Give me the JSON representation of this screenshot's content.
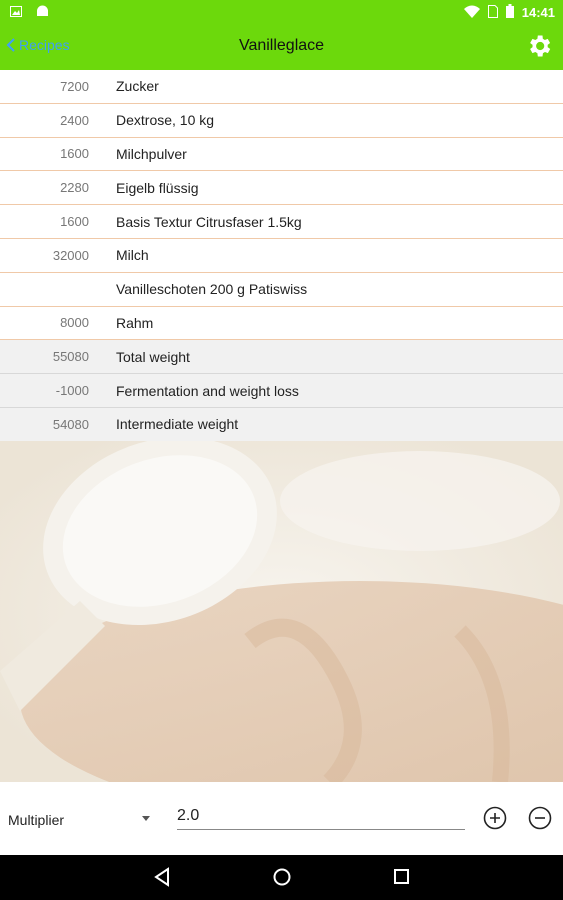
{
  "status": {
    "time": "14:41",
    "icons": [
      "image-icon",
      "android-icon",
      "wifi-icon",
      "sim-icon",
      "battery-icon"
    ]
  },
  "appbar": {
    "back_label": "Recipes",
    "title": "Vanilleglace",
    "settings_icon": "gear-icon",
    "color": "#6cd90c",
    "back_color": "#3fa0f5"
  },
  "ingredients": [
    {
      "amount": "7200",
      "name": "Zucker"
    },
    {
      "amount": "2400",
      "name": "Dextrose, 10 kg"
    },
    {
      "amount": "1600",
      "name": "Milchpulver"
    },
    {
      "amount": "2280",
      "name": "Eigelb flüssig"
    },
    {
      "amount": "1600",
      "name": "Basis Textur Citrusfaser 1.5kg"
    },
    {
      "amount": "32000",
      "name": "Milch"
    },
    {
      "amount": "",
      "name": "Vanilleschoten 200 g Patiswiss"
    },
    {
      "amount": "8000",
      "name": "Rahm"
    }
  ],
  "totals": [
    {
      "amount": "55080",
      "name": "Total weight"
    },
    {
      "amount": "-1000",
      "name": "Fermentation and weight loss"
    },
    {
      "amount": "54080",
      "name": "Intermediate weight"
    }
  ],
  "bottom": {
    "multiplier_label": "Multiplier",
    "multiplier_value": "2.0",
    "plus_icon": "plus-circle-icon",
    "minus_icon": "minus-circle-icon"
  },
  "nav": {
    "icons": [
      "back-triangle-icon",
      "home-circle-icon",
      "recents-square-icon"
    ]
  }
}
